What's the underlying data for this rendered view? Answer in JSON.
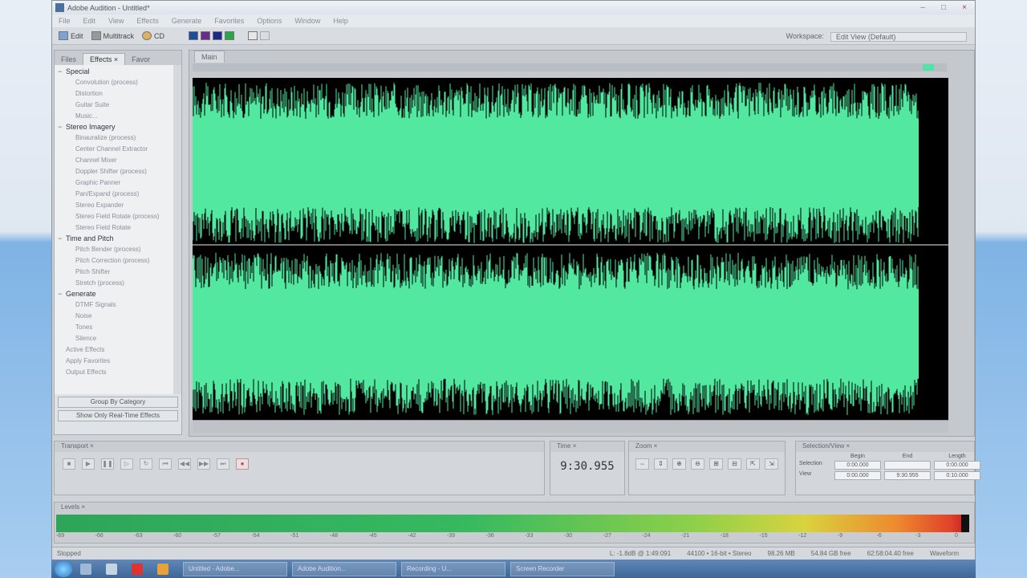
{
  "window": {
    "title": "Adobe Audition - Untitled*",
    "controls": [
      "–",
      "□",
      "×"
    ]
  },
  "menu": [
    "File",
    "Edit",
    "View",
    "Effects",
    "Generate",
    "Favorites",
    "Options",
    "Window",
    "Help"
  ],
  "toolbar": {
    "edit_label": "Edit",
    "multitrack_label": "Multitrack",
    "cd_label": "CD",
    "workspace_label": "Workspace:",
    "workspace_value": "Edit View (Default)"
  },
  "left_panel": {
    "tabs": [
      "Files",
      "Effects ×",
      "Favor"
    ],
    "categories": [
      {
        "name": "Special",
        "items": [
          "Convolution (process)",
          "Distortion",
          "Guitar Suite",
          "Music..."
        ]
      },
      {
        "name": "Stereo Imagery",
        "items": [
          "Binauralize (process)",
          "Center Channel Extractor",
          "Channel Mixer",
          "Doppler Shifter (process)",
          "Graphic Panner",
          "Pan/Expand (process)",
          "Stereo Expander",
          "Stereo Field Rotate (process)",
          "Stereo Field Rotate"
        ]
      },
      {
        "name": "Time and Pitch",
        "items": [
          "Pitch Bender (process)",
          "Pitch Correction (process)",
          "Pitch Shifter",
          "Stretch (process)"
        ]
      },
      {
        "name": "Generate",
        "items": [
          "DTMF Signals",
          "Noise",
          "Tones",
          "Silence"
        ]
      }
    ],
    "extra_items": [
      "Active Effects",
      "Apply Favorites",
      "Output Effects"
    ],
    "group_btn": "Group By Category",
    "show_btn": "Show Only Real-Time Effects"
  },
  "main_panel": {
    "tab": "Main"
  },
  "transport": {
    "title": "Transport ×",
    "buttons": [
      "■",
      "▶",
      "❚❚",
      "▷",
      "↻",
      "⏮",
      "◀◀",
      "▶▶",
      "⏭",
      "●"
    ]
  },
  "time": {
    "title": "Time ×",
    "display": "9:30.955"
  },
  "zoom": {
    "title": "Zoom ×",
    "buttons": [
      "⇔",
      "⇕",
      "⊕",
      "⊖",
      "⊞",
      "⊟",
      "⇱",
      "⇲"
    ]
  },
  "selection": {
    "title": "Selection/View ×",
    "headers": [
      "Begin",
      "End",
      "Length"
    ],
    "rows": [
      {
        "label": "Selection",
        "begin": "0:00.000",
        "end": "",
        "length": "0:00.000"
      },
      {
        "label": "View",
        "begin": "0:00.000",
        "end": "9:30.955",
        "length": "0:10.000"
      }
    ]
  },
  "levels": {
    "title": "Levels ×",
    "scale": [
      "-69",
      "-66",
      "-63",
      "-60",
      "-57",
      "-54",
      "-51",
      "-48",
      "-45",
      "-42",
      "-39",
      "-36",
      "-33",
      "-30",
      "-27",
      "-24",
      "-21",
      "-18",
      "-15",
      "-12",
      "-9",
      "-6",
      "-3",
      "0"
    ]
  },
  "status": {
    "left": "Stopped",
    "items": [
      "L: -1.8dB @ 1:49:091",
      "44100 • 16-bit • Stereo",
      "98.26 MB",
      "54.84 GB free",
      "62:58:04.40 free"
    ],
    "mode": "Waveform"
  },
  "taskbar": {
    "apps": [
      "Untitled - Adobe...",
      "Adobe Audition...",
      "Recording - U...",
      "Screen Recorder"
    ]
  }
}
